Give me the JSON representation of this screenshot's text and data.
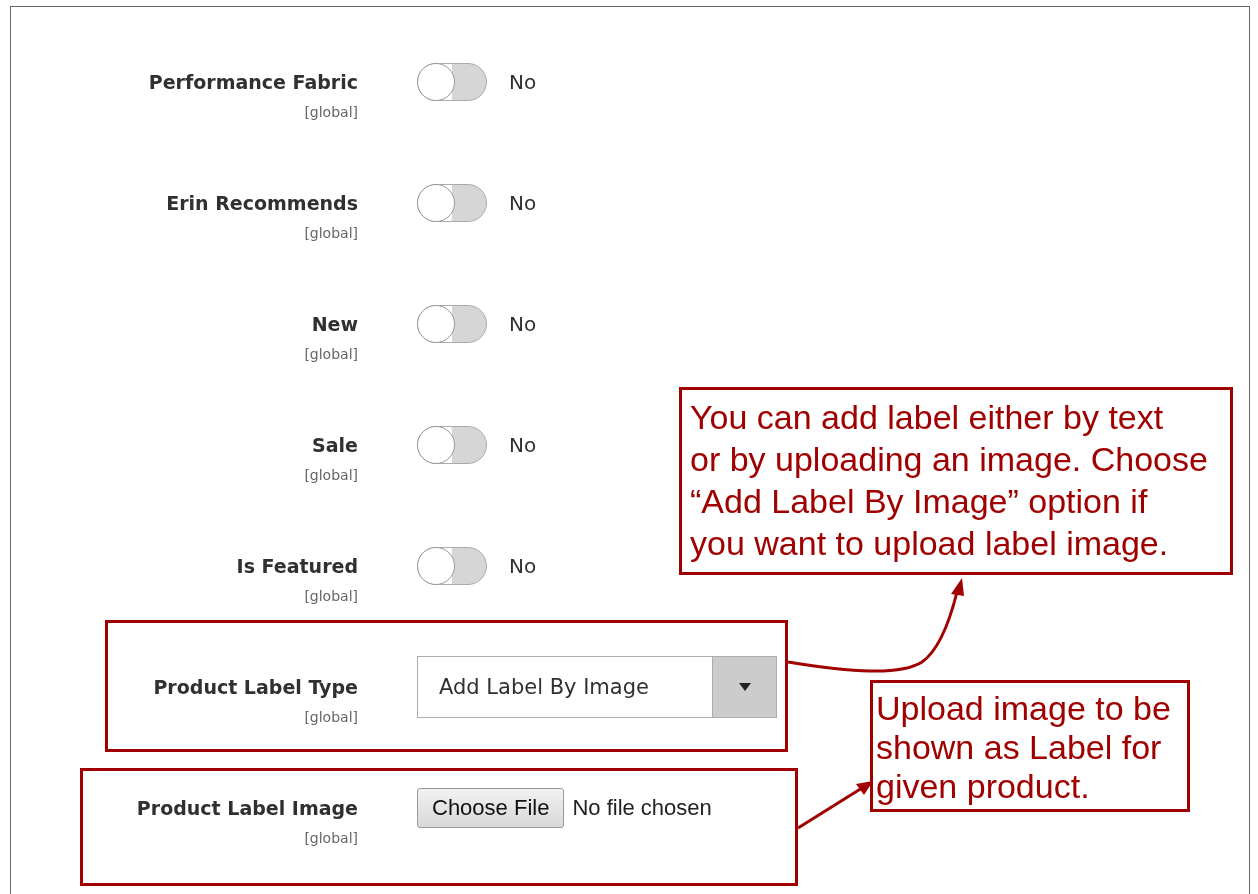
{
  "fields": [
    {
      "kind": "toggle",
      "label": "Performance Fabric",
      "scope": "[global]",
      "on": false,
      "value": "No"
    },
    {
      "kind": "toggle",
      "label": "Erin Recommends",
      "scope": "[global]",
      "on": false,
      "value": "No"
    },
    {
      "kind": "toggle",
      "label": "New",
      "scope": "[global]",
      "on": false,
      "value": "No"
    },
    {
      "kind": "toggle",
      "label": "Sale",
      "scope": "[global]",
      "on": false,
      "value": "No"
    },
    {
      "kind": "toggle",
      "label": "Is Featured",
      "scope": "[global]",
      "on": false,
      "value": "No"
    },
    {
      "kind": "select",
      "label": "Product Label Type",
      "scope": "[global]",
      "value": "Add Label By Image"
    },
    {
      "kind": "file",
      "label": "Product Label Image",
      "scope": "[global]",
      "button": "Choose File",
      "value": "No file chosen"
    }
  ],
  "callouts": [
    {
      "lines": [
        "You can add label either by text",
        "or by uploading an image. Choose",
        "“Add Label By Image” option if",
        "you want to upload label image."
      ]
    },
    {
      "lines": [
        "Upload image to be",
        "shown as Label for",
        "given product."
      ]
    }
  ]
}
